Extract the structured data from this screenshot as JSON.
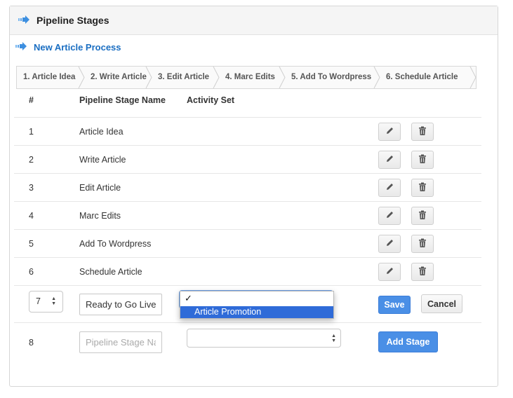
{
  "header": {
    "title": "Pipeline Stages",
    "icon": "arrow-right-icon"
  },
  "process": {
    "title": "New Article Process",
    "icon": "arrow-right-icon"
  },
  "steps": [
    "1. Article Idea",
    "2. Write Article",
    "3. Edit Article",
    "4. Marc Edits",
    "5. Add To Wordpress",
    "6. Schedule Article"
  ],
  "table": {
    "headers": {
      "num": "#",
      "name": "Pipeline Stage Name",
      "activity": "Activity Set"
    },
    "rows": [
      {
        "num": "1",
        "name": "Article Idea"
      },
      {
        "num": "2",
        "name": "Write Article"
      },
      {
        "num": "3",
        "name": "Edit Article"
      },
      {
        "num": "4",
        "name": "Marc Edits"
      },
      {
        "num": "5",
        "name": "Add To Wordpress"
      },
      {
        "num": "6",
        "name": "Schedule Article"
      }
    ]
  },
  "edit_row": {
    "order_value": "7",
    "name_value": "Ready to Go Live",
    "activity_selected": "",
    "save_label": "Save",
    "cancel_label": "Cancel"
  },
  "dropdown": {
    "checkmark": "✓",
    "options": [
      "Article Promotion"
    ]
  },
  "new_row": {
    "num": "8",
    "name_placeholder": "Pipeline Stage Name",
    "activity_selected": "",
    "add_label": "Add Stage"
  },
  "colors": {
    "accent": "#4a8fe6",
    "link": "#1a6ec2",
    "highlight": "#2f6bd8"
  }
}
